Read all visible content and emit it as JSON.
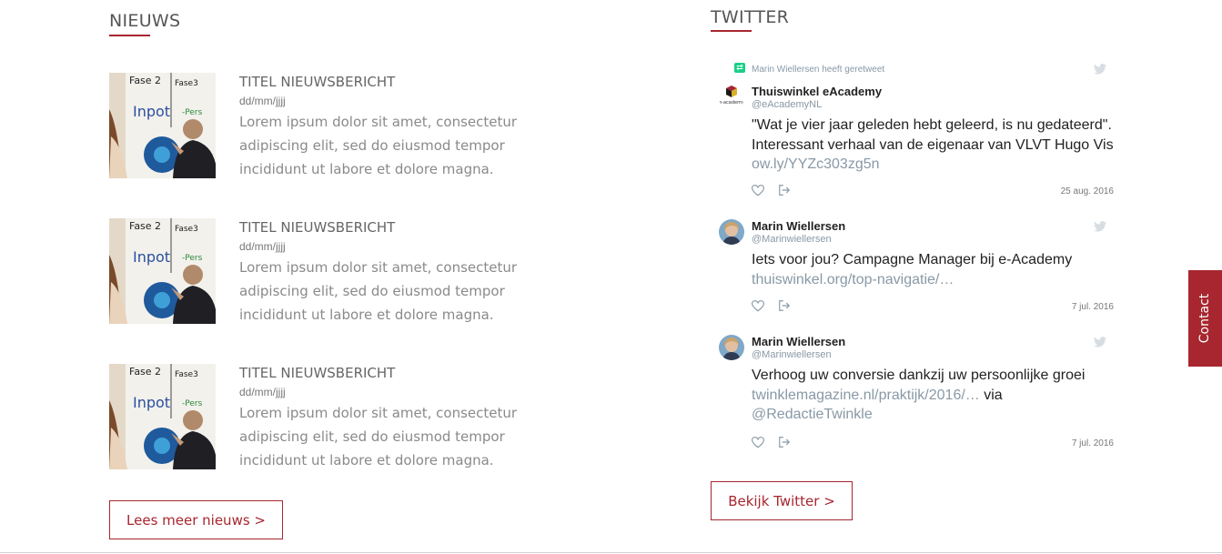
{
  "news": {
    "heading": "NIEUWS",
    "items": [
      {
        "title": "TITEL NIEUWSBERICHT",
        "date": "dd/mm/jjjj",
        "body": "Lorem ipsum dolor sit amet, consectetur adipiscing elit, sed do eiusmod tempor incididunt ut labore et dolore magna."
      },
      {
        "title": "TITEL NIEUWSBERICHT",
        "date": "dd/mm/jjjj",
        "body": "Lorem ipsum dolor sit amet, consectetur adipiscing elit, sed do eiusmod tempor incididunt ut labore et dolore magna."
      },
      {
        "title": "TITEL NIEUWSBERICHT",
        "date": "dd/mm/jjjj",
        "body": "Lorem ipsum dolor sit amet, consectetur adipiscing elit, sed do eiusmod tempor incididunt ut labore et dolore magna."
      }
    ],
    "more_button": "Lees meer nieuws >"
  },
  "twitter": {
    "heading": "TWITTER",
    "tweets": [
      {
        "retweet_label": "Marin Wiellersen heeft geretweet",
        "name": "Thuiswinkel eAcademy",
        "handle": "@eAcademyNL",
        "text": "\"Wat je vier jaar geleden hebt geleerd, is nu gedateerd\". Interessant verhaal van de eigenaar van VLVT Hugo Vis",
        "link": "ow.ly/YYZc303zg5n",
        "date": "25 aug. 2016",
        "avatar_caption": "e-academy"
      },
      {
        "name": "Marin Wiellersen",
        "handle": "@Marinwiellersen",
        "text": "Iets voor jou? Campagne Manager bij e-Academy",
        "link": "thuiswinkel.org/top-navigatie/…",
        "date": "7 jul. 2016"
      },
      {
        "name": "Marin Wiellersen",
        "handle": "@Marinwiellersen",
        "text": "Verhoog uw conversie dankzij uw persoonlijke groei",
        "link": "twinklemagazine.nl/praktijk/2016/…",
        "after_link": "via",
        "mention": "@RedactieTwinkle",
        "date": "7 jul. 2016"
      }
    ],
    "more_button": "Bekijk Twitter >"
  },
  "contact_tab": "Contact",
  "colors": {
    "accent": "#a8262f",
    "muted_link": "#8899a6",
    "body_text": "#8a8a8a"
  },
  "icons": {
    "like": "heart-icon",
    "share": "share-icon",
    "twitter": "twitter-bird-icon",
    "retweet": "retweet-icon"
  }
}
